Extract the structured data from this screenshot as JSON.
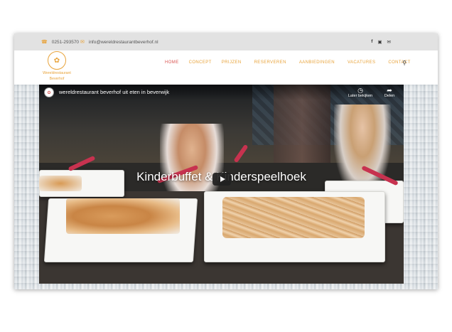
{
  "topbar": {
    "phone": "0251-293570",
    "email": "info@wereldrestaurantbeverhof.nl",
    "phone_icon": "phone-icon",
    "email_icon": "envelope-icon",
    "social": [
      "facebook-icon",
      "instagram-icon",
      "mail-icon"
    ]
  },
  "logo": {
    "name_line1": "Wereldrestaurant",
    "name_line2": "Beverhof"
  },
  "nav": {
    "items": [
      "HOME",
      "CONCEPT",
      "PRIJZEN",
      "RESERVEREN",
      "AANBIEDINGEN",
      "VACATURES",
      "CONTACT"
    ],
    "active": "HOME",
    "search_icon": "search-icon"
  },
  "video": {
    "title": "wereldrestaurant beverhof uit eten in beverwijk",
    "overlay_title": "Kinderbuffet & Kinderspeelhoek",
    "later_label": "Later bekijken",
    "share_label": "Delen"
  },
  "colors": {
    "accent": "#e8a33a",
    "active_nav": "#d9534f",
    "topbar_bg": "#e2e2e2"
  }
}
